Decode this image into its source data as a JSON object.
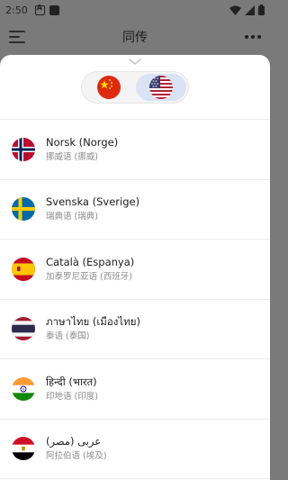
{
  "status_bar": {
    "time": "2:50",
    "icons": [
      "notification-a-icon",
      "notification-square-icon",
      "wifi-icon",
      "signal-icon",
      "battery-icon"
    ]
  },
  "app_bar": {
    "title": "同传",
    "left_icon": "menu-icon",
    "right_icon": "more-options-icon"
  },
  "sheet": {
    "handle_icon": "chevron-down-icon",
    "toggle": {
      "left": {
        "flag": "china-flag-icon",
        "selected": false
      },
      "right": {
        "flag": "us-flag-icon",
        "selected": true
      }
    },
    "languages": [
      {
        "flag": "norway-flag-icon",
        "name": "Norsk (Norge)",
        "subtitle": "挪威语 (挪威)"
      },
      {
        "flag": "sweden-flag-icon",
        "name": "Svenska (Sverige)",
        "subtitle": "瑞典语 (瑞典)"
      },
      {
        "flag": "spain-flag-icon",
        "name": "Català (Espanya)",
        "subtitle": "加泰罗尼亚语 (西班牙)"
      },
      {
        "flag": "thailand-flag-icon",
        "name": "ภาษาไทย (เมืองไทย)",
        "subtitle": "泰语 (泰国)"
      },
      {
        "flag": "india-flag-icon",
        "name": "हिन्दी (भारत)",
        "subtitle": "印地语 (印度)"
      },
      {
        "flag": "egypt-flag-icon",
        "name": "عربی (مصر)",
        "subtitle": "阿拉伯语 (埃及)"
      }
    ]
  }
}
